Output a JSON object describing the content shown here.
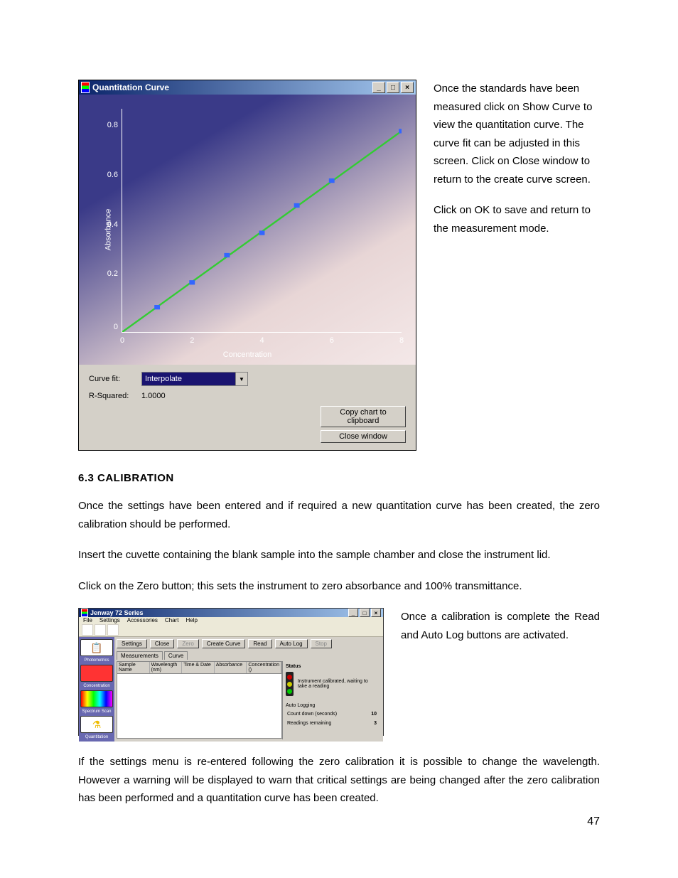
{
  "page_number": "47",
  "figure1": {
    "window_title": "Quantitation Curve",
    "curve_fit_label": "Curve fit:",
    "curve_fit_value": "Interpolate",
    "r_squared_label": "R-Squared:",
    "r_squared_value": "1.0000",
    "copy_btn": "Copy chart to clipboard",
    "close_btn": "Close window"
  },
  "chart_data": {
    "type": "scatter",
    "xlabel": "Concentration",
    "ylabel": "Absorbance",
    "xlim": [
      0,
      8
    ],
    "ylim": [
      0,
      0.9
    ],
    "xticks": [
      0,
      2,
      4,
      6,
      8
    ],
    "yticks": [
      0,
      0.2,
      0.4,
      0.6,
      0.8
    ],
    "x": [
      1,
      2,
      3,
      4,
      5,
      6,
      8
    ],
    "y": [
      0.1,
      0.2,
      0.31,
      0.4,
      0.51,
      0.61,
      0.81
    ],
    "fit_line": {
      "x": [
        0,
        8
      ],
      "y": [
        0,
        0.81
      ]
    },
    "title": "Quantitation Curve"
  },
  "side1": {
    "p1": "Once the standards have been measured click on Show Curve to view the quantitation curve. The curve fit can be adjusted in this screen. Click on Close window to return to the create curve screen.",
    "p2": "Click on OK to save and return to the measurement mode."
  },
  "section": {
    "heading": "6.3  CALIBRATION",
    "p1": "Once the settings have been entered and if required a new quantitation curve has been created, the zero calibration should be performed.",
    "p2": "Insert the cuvette containing the blank sample into the sample chamber and close the instrument lid.",
    "p3": "Click on the Zero button; this sets the instrument to zero absorbance and 100% transmittance."
  },
  "figure2": {
    "window_title": "Jenway 72 Series",
    "menu": [
      "File",
      "Settings",
      "Accessories",
      "Chart",
      "Help"
    ],
    "sidebar": [
      {
        "icon": "clipboard",
        "label": "Photometrics"
      },
      {
        "icon": "red-square",
        "label": "Concentration"
      },
      {
        "icon": "spectrum",
        "label": "Spectrum Scan"
      },
      {
        "icon": "flask",
        "label": "Quantitation"
      }
    ],
    "buttons": [
      "Settings",
      "Close",
      "Zero",
      "Create Curve",
      "Read",
      "Auto Log",
      "Stop"
    ],
    "tabs": [
      "Measurements",
      "Curve"
    ],
    "columns": [
      "Sample Name",
      "Wavelength (nm)",
      "Time & Date",
      "Absorbance",
      "Concentration ()"
    ],
    "status_header": "Status",
    "status_text": "Instrument calibrated, waiting to take a reading",
    "autolog_header": "Auto Logging",
    "countdown_label": "Count down (seconds)",
    "countdown_value": "10",
    "remaining_label": "Readings remaining",
    "remaining_value": "3"
  },
  "side2": {
    "p1": "Once a calibration is complete the Read and Auto Log buttons are activated."
  },
  "after": {
    "p1": "If the settings menu is re-entered following the zero calibration it is possible to change the wavelength. However a warning will be displayed to warn that critical settings are being changed after the zero calibration has been performed and a quantitation curve has been created."
  }
}
